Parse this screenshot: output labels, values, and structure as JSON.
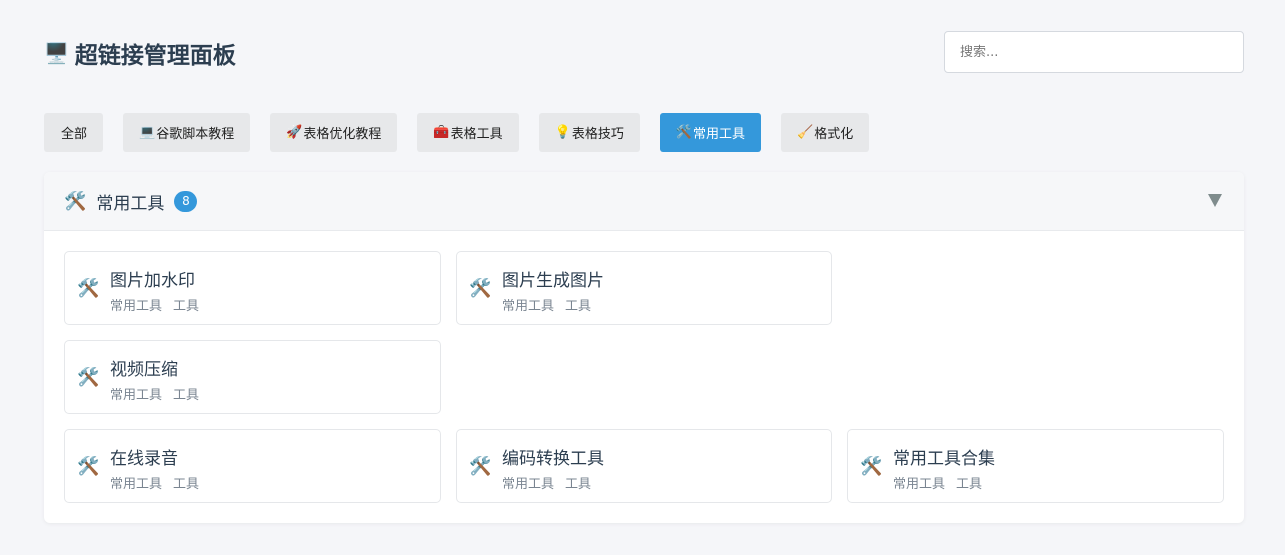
{
  "header": {
    "icon": "🖥️",
    "icon_name": "computer-icon",
    "title": "超链接管理面板"
  },
  "search": {
    "placeholder": "搜索...",
    "value": ""
  },
  "filters": [
    {
      "icon": "",
      "label": "全部",
      "active": false
    },
    {
      "icon": "💻",
      "label": "谷歌脚本教程",
      "active": false
    },
    {
      "icon": "🚀",
      "label": "表格优化教程",
      "active": false
    },
    {
      "icon": "🧰",
      "label": "表格工具",
      "active": false
    },
    {
      "icon": "💡",
      "label": "表格技巧",
      "active": false
    },
    {
      "icon": "🛠️",
      "label": "常用工具",
      "active": true
    },
    {
      "icon": "🧹",
      "label": "格式化",
      "active": false
    }
  ],
  "section": {
    "icon": "🛠️",
    "icon_name": "tools-icon",
    "title": "常用工具",
    "count": "8",
    "toggle_icon": "collapse-triangle-icon"
  },
  "cards": [
    {
      "icon": "🛠️",
      "name": "图片加水印",
      "tags": [
        "常用工具",
        "工具"
      ]
    },
    {
      "icon": "🛠️",
      "name": "图片生成图片",
      "tags": [
        "常用工具",
        "工具"
      ]
    },
    {
      "icon": "🛠️",
      "name": "视频压缩",
      "tags": [
        "常用工具",
        "工具"
      ]
    },
    {
      "icon": "🛠️",
      "name": "在线录音",
      "tags": [
        "常用工具",
        "工具"
      ]
    },
    {
      "icon": "🛠️",
      "name": "编码转换工具",
      "tags": [
        "常用工具",
        "工具"
      ]
    },
    {
      "icon": "🛠️",
      "name": "常用工具合集",
      "tags": [
        "常用工具",
        "工具"
      ]
    }
  ],
  "colors": {
    "accent": "#3498db",
    "background": "#f5f6f9",
    "text": "#2c3e50"
  }
}
